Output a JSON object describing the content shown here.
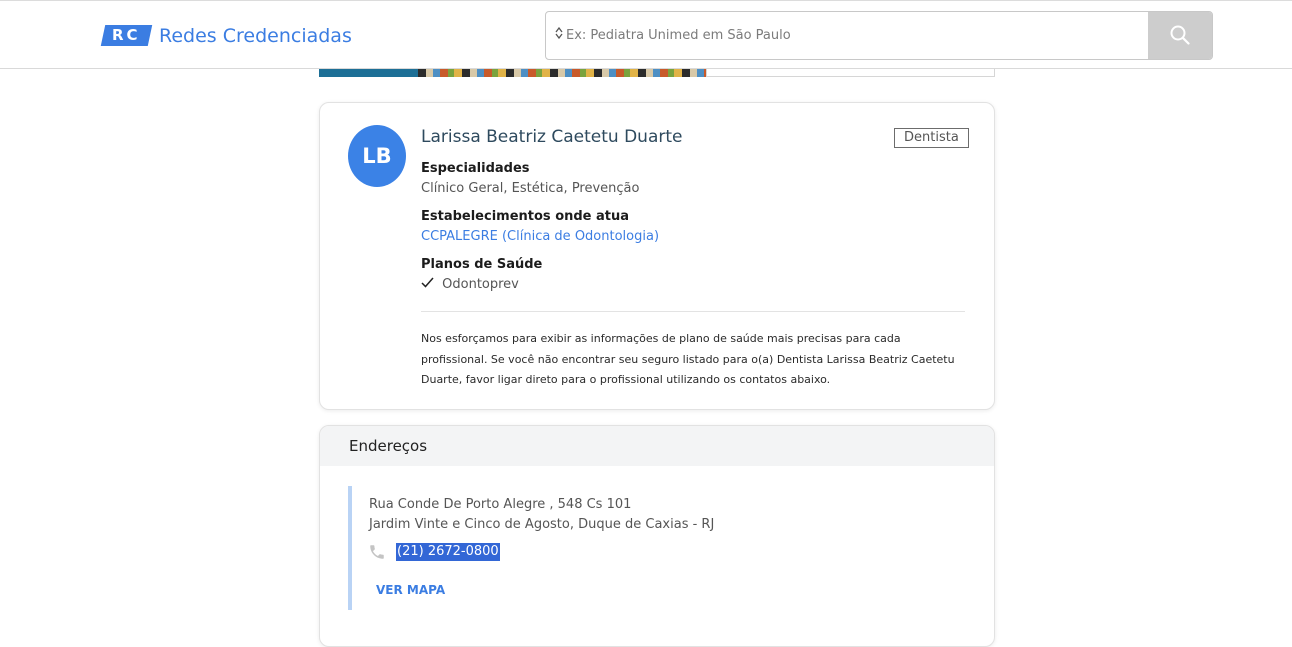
{
  "header": {
    "logo_text": "RC",
    "brand": "Redes Credenciadas",
    "search_placeholder": "Ex: Pediatra Unimed em São Paulo"
  },
  "profile": {
    "initials": "LB",
    "name": "Larissa Beatriz Caetetu Duarte",
    "tag": "Dentista",
    "specialties_label": "Especialidades",
    "specialties": "Clínico Geral, Estética, Prevenção",
    "establishments_label": "Estabelecimentos onde atua",
    "establishment": "CCPALEGRE (Clínica de Odontologia)",
    "plans_label": "Planos de Saúde",
    "plan": "Odontoprev",
    "note": "Nos esforçamos para exibir as informações de plano de saúde mais precisas para cada profissional. Se você não encontrar seu seguro listado para o(a) Dentista Larissa Beatriz Caetetu Duarte, favor ligar direto para o profissional utilizando os contatos abaixo."
  },
  "addresses": {
    "title": "Endereços",
    "items": [
      {
        "line1": "Rua Conde De Porto Alegre , 548 Cs 101",
        "line2": "Jardim Vinte e Cinco de Agosto, Duque de Caxias - RJ",
        "phone": "(21) 2672-0800",
        "map_label": "VER MAPA"
      }
    ]
  },
  "colors": {
    "accent": "#3b7de2",
    "avatar": "#3b82e6",
    "selection": "#3367d6"
  }
}
